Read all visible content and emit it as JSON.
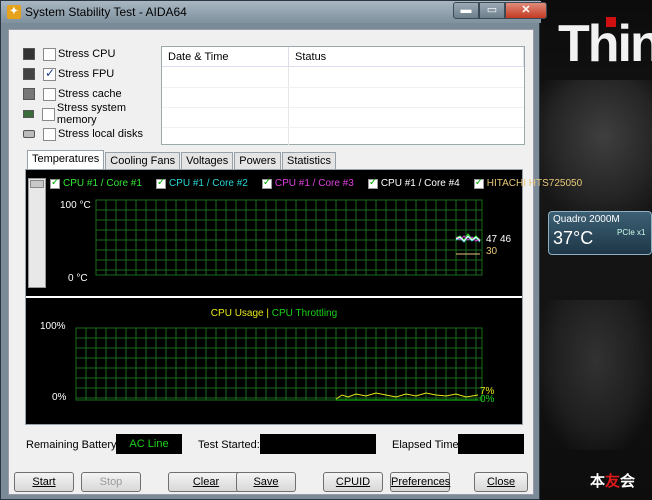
{
  "window": {
    "title": "System Stability Test - AIDA64"
  },
  "titlebar_buttons": {
    "min": "▬",
    "max": "▭",
    "close": "✕"
  },
  "stress": [
    {
      "label": "Stress CPU",
      "checked": false,
      "icon": "cpu-icon"
    },
    {
      "label": "Stress FPU",
      "checked": true,
      "icon": "fpu-icon"
    },
    {
      "label": "Stress cache",
      "checked": false,
      "icon": "cache-icon"
    },
    {
      "label": "Stress system memory",
      "checked": false,
      "icon": "memory-icon"
    },
    {
      "label": "Stress local disks",
      "checked": false,
      "icon": "disk-icon"
    }
  ],
  "log": {
    "columns": [
      "Date & Time",
      "Status"
    ]
  },
  "tabs": [
    "Temperatures",
    "Cooling Fans",
    "Voltages",
    "Powers",
    "Statistics"
  ],
  "temp_chart": {
    "legend": [
      {
        "label": "CPU #1 / Core #1",
        "color": "#32e832",
        "checked": true
      },
      {
        "label": "CPU #1 / Core #2",
        "color": "#28d8d8",
        "checked": true
      },
      {
        "label": "CPU #1 / Core #3",
        "color": "#e040e0",
        "checked": true
      },
      {
        "label": "CPU #1 / Core #4",
        "color": "#ffffff",
        "checked": true
      },
      {
        "label": "HITACHI HTS725050",
        "color": "#e8c878",
        "checked": true
      }
    ],
    "y_top": "100 °C",
    "y_bottom": "0 °C",
    "readings": [
      "47",
      "46",
      "30"
    ]
  },
  "cpu_chart": {
    "title_usage": "CPU Usage",
    "separator": "|",
    "title_throttle": "CPU Throttling",
    "y_top": "100%",
    "y_bottom": "0%",
    "readings": [
      "7%",
      "0%"
    ]
  },
  "status": {
    "battery_label": "Remaining Battery:",
    "battery_value": "AC Line",
    "started_label": "Test Started:",
    "started_value": "",
    "elapsed_label": "Elapsed Time:",
    "elapsed_value": ""
  },
  "buttons": {
    "start": "Start",
    "stop": "Stop",
    "clear": "Clear",
    "save": "Save",
    "cpuid": "CPUID",
    "preferences": "Preferences",
    "close": "Close"
  },
  "desktop": {
    "brand": "Think",
    "gadget_name": "Quadro 2000M",
    "gadget_temp": "37°C",
    "gadget_bus": "PCIe x1",
    "logo_part1": "本",
    "logo_part2": "友",
    "logo_part3": "会"
  },
  "colors": {
    "grid": "#1d6b1d",
    "green_text": "#1bd21b",
    "yellow_text": "#e8e81b"
  }
}
